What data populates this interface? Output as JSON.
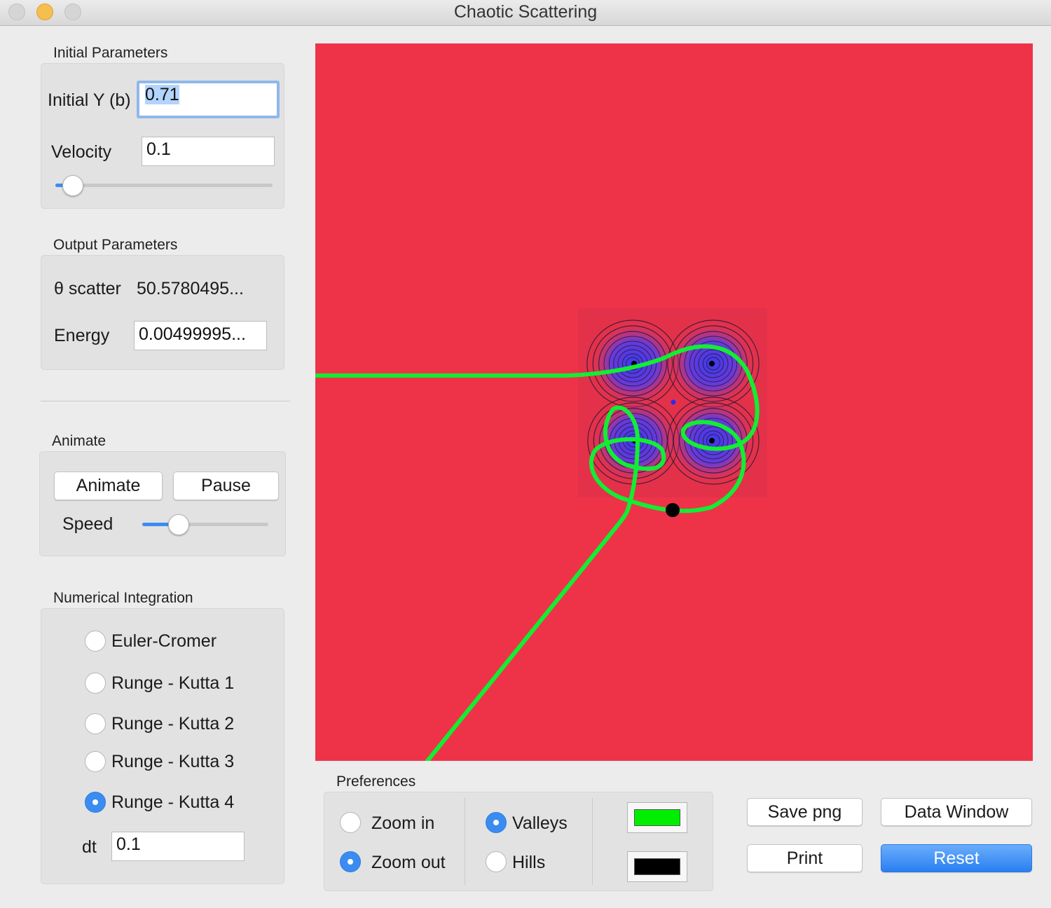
{
  "window": {
    "title": "Chaotic Scattering"
  },
  "initial_parameters": {
    "group_label": "Initial Parameters",
    "initial_y_label": "Initial Y (b)",
    "initial_y_value": "0.71",
    "velocity_label": "Velocity",
    "velocity_value": "0.1",
    "velocity_slider_level": 0.08
  },
  "output_parameters": {
    "group_label": "Output Parameters",
    "theta_label": "θ scatter",
    "theta_value": "50.5780495...",
    "energy_label": "Energy",
    "energy_value": "0.00499995..."
  },
  "animate": {
    "group_label": "Animate",
    "animate_label": "Animate",
    "pause_label": "Pause",
    "speed_label": "Speed",
    "speed_slider_level": 0.29
  },
  "numerical_integration": {
    "group_label": "Numerical Integration",
    "methods": [
      {
        "label": "Euler-Cromer",
        "selected": false
      },
      {
        "label": "Runge - Kutta 1",
        "selected": false
      },
      {
        "label": "Runge - Kutta 2",
        "selected": false
      },
      {
        "label": "Runge - Kutta 3",
        "selected": false
      },
      {
        "label": "Runge - Kutta 4",
        "selected": true
      }
    ],
    "dt_label": "dt",
    "dt_value": "0.1"
  },
  "preferences": {
    "group_label": "Preferences",
    "zoom_in_label": "Zoom in",
    "zoom_out_label": "Zoom out",
    "zoom_selected": "Zoom out",
    "valleys_label": "Valleys",
    "hills_label": "Hills",
    "terrain_selected": "Valleys",
    "trajectory_color": "#00ee00",
    "particle_color": "#000000"
  },
  "actions": {
    "save_png_label": "Save png",
    "data_window_label": "Data Window",
    "print_label": "Print",
    "reset_label": "Reset"
  },
  "plot": {
    "background_color": "#ee3349",
    "trajectory_color": "#11ee33",
    "valley_center_color": "#3a3af0"
  }
}
